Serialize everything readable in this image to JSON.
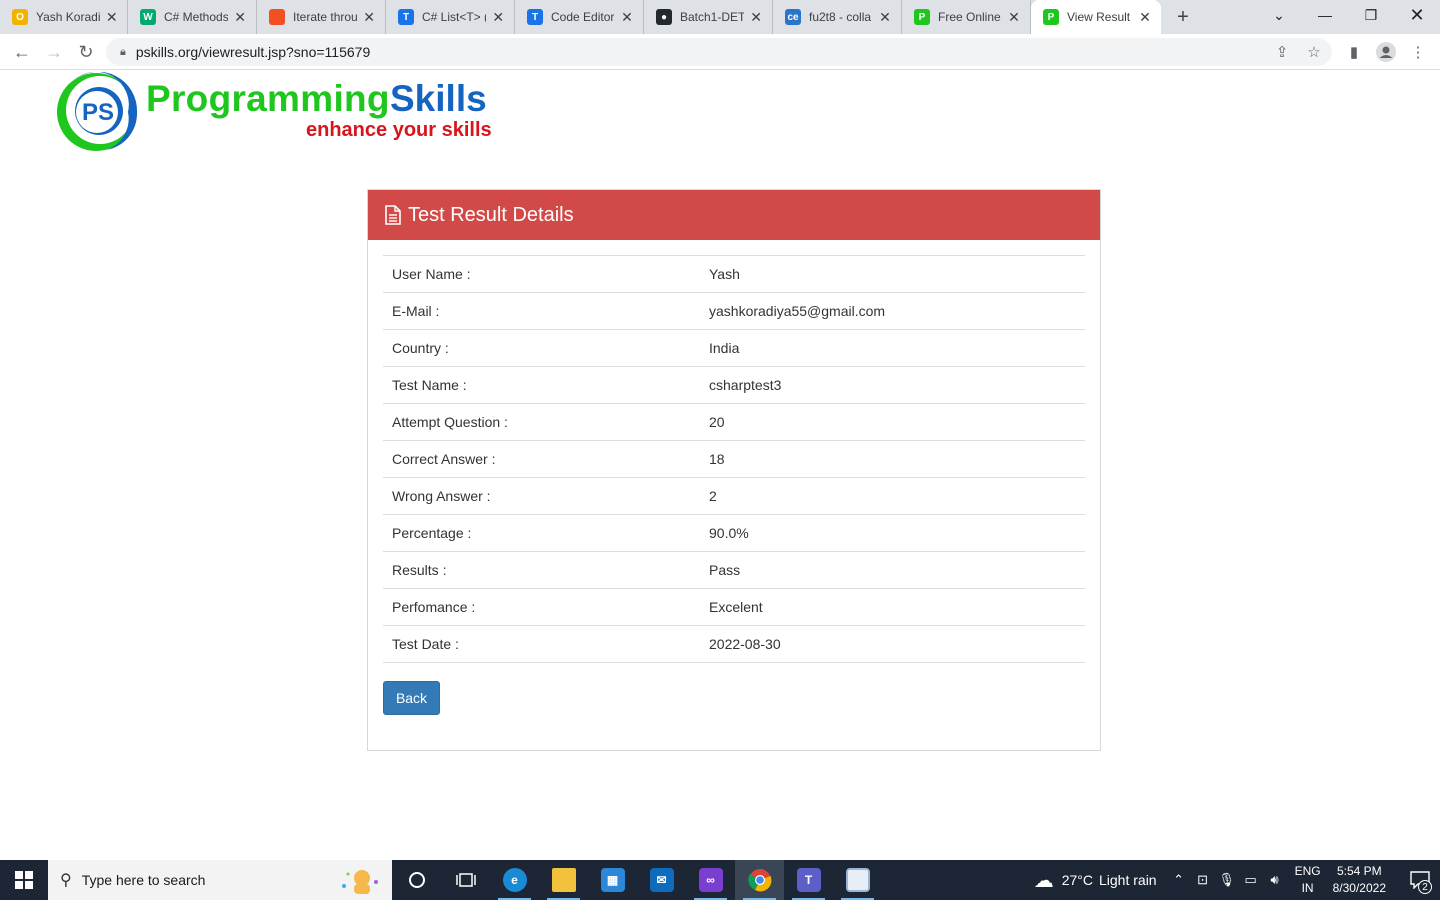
{
  "browser": {
    "tabs": [
      {
        "title": "Yash Koradiy",
        "icon": "outlook-icon",
        "color": "#f0b400",
        "glyph": "O"
      },
      {
        "title": "C# Methods",
        "icon": "w3schools-icon",
        "color": "#04aa6d",
        "glyph": "W"
      },
      {
        "title": "Iterate throu",
        "icon": "microsoft-icon",
        "color": "#f25022",
        "glyph": ""
      },
      {
        "title": "C# List<T> (",
        "icon": "code-editor-icon",
        "color": "#1a73e8",
        "glyph": "T"
      },
      {
        "title": "Code Editor",
        "icon": "code-editor-icon",
        "color": "#1a73e8",
        "glyph": "T"
      },
      {
        "title": "Batch1-DET",
        "icon": "github-icon",
        "color": "#24292f",
        "glyph": "●"
      },
      {
        "title": "fu2t8 - colla",
        "icon": "collabedit-icon",
        "color": "#2a74c9",
        "glyph": "ce"
      },
      {
        "title": "Free Online",
        "icon": "pskills-icon",
        "color": "#1ec61e",
        "glyph": "P"
      },
      {
        "title": "View Result",
        "icon": "pskills-icon",
        "color": "#1ec61e",
        "glyph": "P"
      }
    ],
    "new_tab": "+",
    "url": "pskills.org/viewresult.jsp?sno=115679"
  },
  "site": {
    "brand_part1": "Programming",
    "brand_part2": "Skills",
    "tagline": "enhance your skills",
    "logo_letters": "PS"
  },
  "panel": {
    "title": "Test Result Details",
    "header_color": "#d24a48",
    "rows": [
      {
        "label": "User Name :",
        "value": "Yash"
      },
      {
        "label": "E-Mail :",
        "value": "yashkoradiya55@gmail.com"
      },
      {
        "label": "Country :",
        "value": "India"
      },
      {
        "label": "Test Name :",
        "value": "csharptest3"
      },
      {
        "label": "Attempt Question :",
        "value": "20"
      },
      {
        "label": "Correct Answer :",
        "value": "18"
      },
      {
        "label": "Wrong Answer :",
        "value": "2"
      },
      {
        "label": "Percentage :",
        "value": "90.0%"
      },
      {
        "label": "Results :",
        "value": "Pass"
      },
      {
        "label": "Perfomance :",
        "value": "Excelent"
      },
      {
        "label": "Test Date :",
        "value": "2022-08-30"
      }
    ],
    "back_label": "Back"
  },
  "taskbar": {
    "search_placeholder": "Type here to search",
    "weather_temp": "27°C",
    "weather_desc": "Light rain",
    "lang_top": "ENG",
    "lang_bottom": "IN",
    "time": "5:54 PM",
    "date": "8/30/2022",
    "notification_count": "2"
  }
}
